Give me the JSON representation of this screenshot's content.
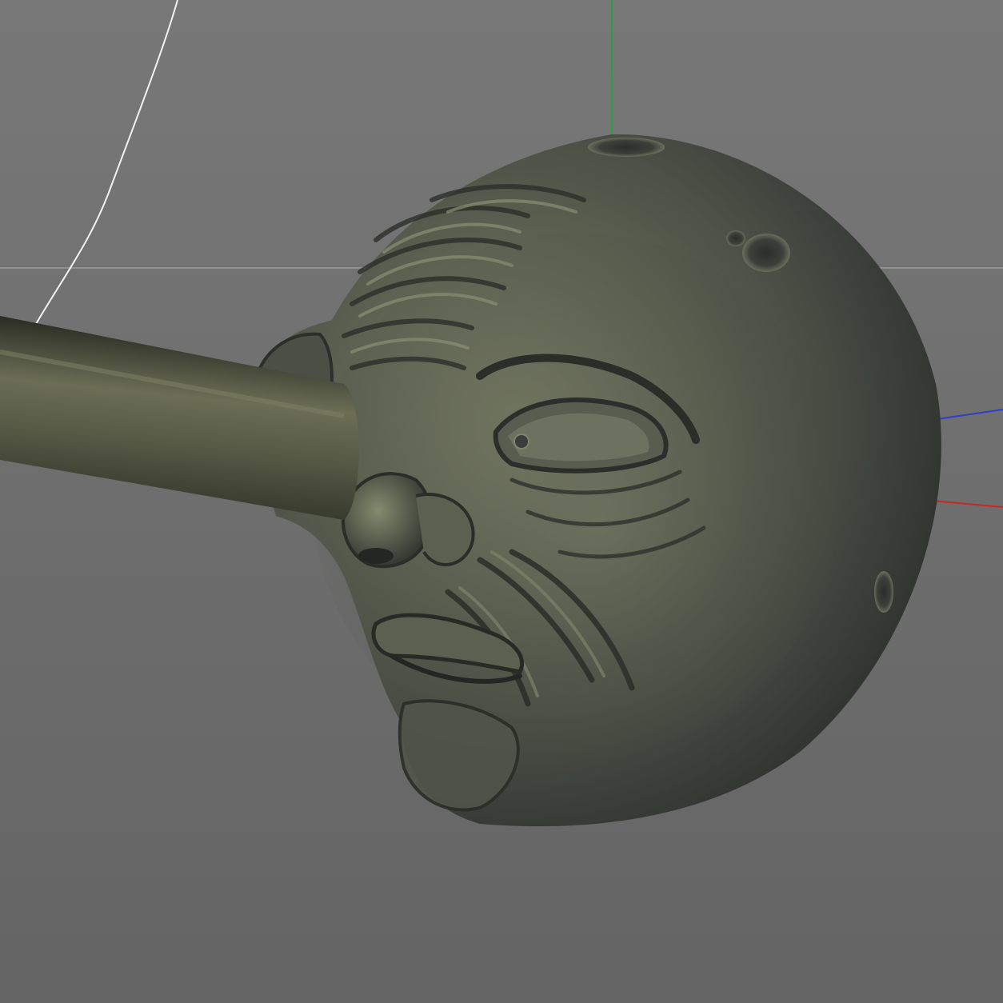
{
  "viewport": {
    "background": "#6e6e6e",
    "background_top": "#787878",
    "background_bottom": "#646464"
  },
  "axes": {
    "x_axis_color": "#c62828",
    "y_axis_color": "#2e9e3a",
    "z_axis_color": "#2f3fc8",
    "horizon_color": "#9a9a9a"
  },
  "spline": {
    "color": "#f2f2f2"
  },
  "model": {
    "object": "moon-face-sculpt",
    "base_color": "#4a4e48",
    "highlight_color": "#8a8f72",
    "shadow_color": "#252825",
    "rod_color": "#50533e"
  }
}
